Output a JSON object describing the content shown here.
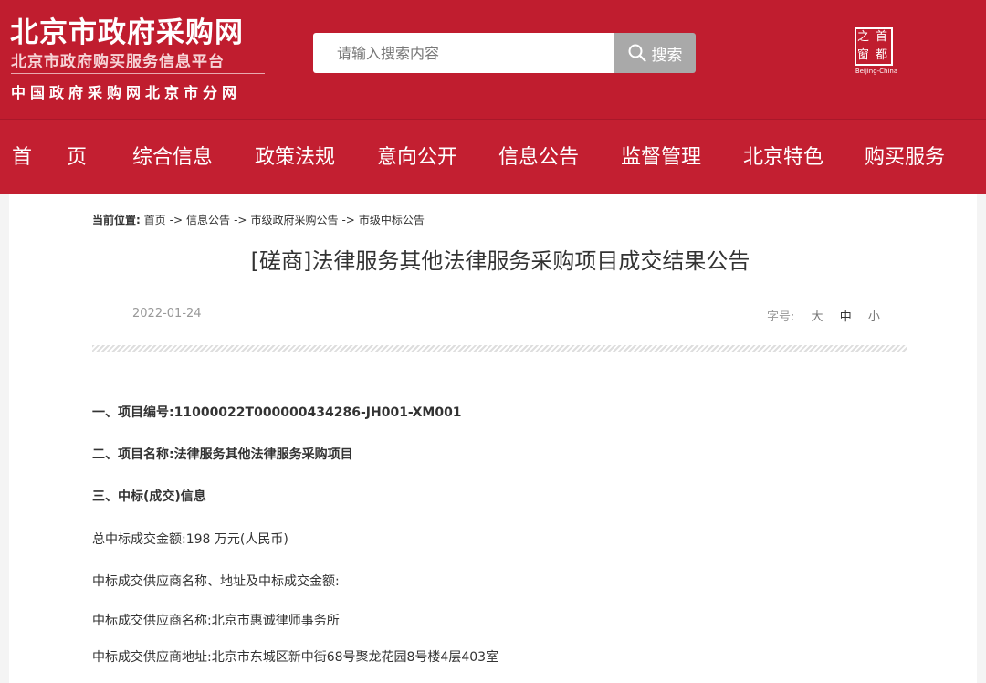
{
  "header": {
    "logo_title": "北京市政府采购网",
    "logo_subtitle": "北京市政府购买服务信息平台",
    "logo_tagline": "中国政府采购网北京市分网",
    "seal": {
      "chars": [
        "之",
        "首",
        "窗",
        "都"
      ],
      "caption": "Beijing-China"
    }
  },
  "search": {
    "placeholder": "请输入搜索内容",
    "button_label": "搜索"
  },
  "nav": {
    "home_chars": [
      "首",
      "页"
    ],
    "items": [
      "综合信息",
      "政策法规",
      "意向公开",
      "信息公告",
      "监督管理",
      "北京特色",
      "购买服务"
    ]
  },
  "breadcrumb": {
    "label": "当前位置:",
    "items": [
      "首页",
      "信息公告",
      "市级政府采购公告",
      "市级中标公告"
    ],
    "separator": "->"
  },
  "article": {
    "title": "[磋商]法律服务其他法律服务采购项目成交结果公告",
    "date": "2022-01-24",
    "font_size_label": "字号:",
    "font_size_options": [
      "大",
      "中",
      "小"
    ],
    "font_size_selected": "中",
    "lines": [
      {
        "text": "一、项目编号:11000022T000000434286-JH001-XM001",
        "bold": true
      },
      {
        "text": "二、项目名称:法律服务其他法律服务采购项目",
        "bold": true
      },
      {
        "text": "三、中标(成交)信息",
        "bold": true
      },
      {
        "text": "总中标成交金额:198 万元(人民币)",
        "bold": false
      },
      {
        "text": "中标成交供应商名称、地址及中标成交金额:",
        "bold": false
      },
      {
        "text": "中标成交供应商名称:北京市惠诚律师事务所",
        "bold": false
      },
      {
        "text": "中标成交供应商地址:北京市东城区新中街68号聚龙花园8号楼4层403室",
        "bold": false
      }
    ]
  },
  "colors": {
    "header_red": "#c01d2f",
    "nav_red": "#c31f31",
    "search_button_gray": "#a9a9a9",
    "body_text": "#333333",
    "muted_text": "#999999"
  },
  "icons": {
    "search": "search-icon",
    "seal": "beijing-seal-logo"
  }
}
